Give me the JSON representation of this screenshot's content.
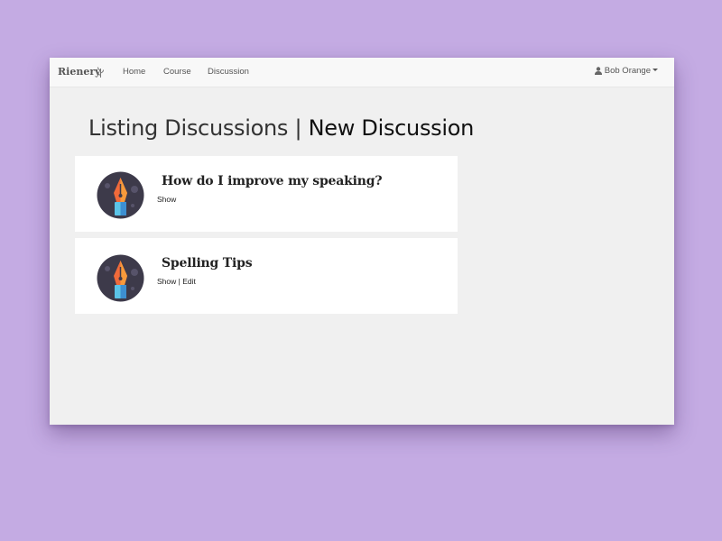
{
  "navbar": {
    "brand": "Rienery",
    "links": [
      "Home",
      "Course",
      "Discussion"
    ],
    "user": "Bob Orange"
  },
  "page": {
    "title": "Listing Discussions",
    "separator": "|",
    "new_link": "New Discussion"
  },
  "discussions": [
    {
      "title": "How do I improve my speaking?",
      "actions": [
        "Show"
      ]
    },
    {
      "title": "Spelling Tips",
      "actions": [
        "Show",
        "Edit"
      ]
    }
  ],
  "colors": {
    "background": "#c4abe3",
    "panel": "#f0f0f0",
    "card": "#ffffff"
  },
  "icons": {
    "brand": "wheat-sprout-icon",
    "user": "user-icon",
    "avatar": "pen-nib-avatar-icon"
  }
}
